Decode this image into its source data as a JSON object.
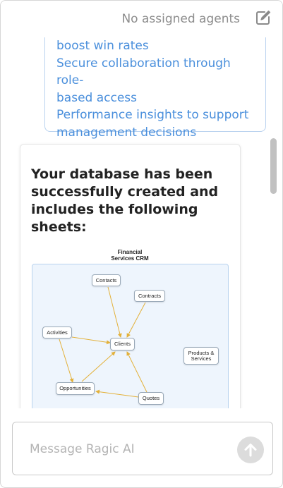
{
  "header": {
    "agents_text": "No assigned agents",
    "edit_icon": "edit-icon"
  },
  "user_message": {
    "lines": [
      "boost win rates",
      "Secure collaboration through role-",
      "based access",
      "Performance insights to support",
      "management decisions"
    ]
  },
  "ai_message": {
    "heading_lines": [
      "Your database has been",
      "successfully created and",
      "includes the following",
      "sheets:"
    ],
    "diagram": {
      "title_lines": [
        "Financial",
        "Services CRM"
      ],
      "nodes": {
        "contacts": "Contacts",
        "contracts": "Contracts",
        "activities": "Activities",
        "clients": "Clients",
        "products_services": [
          "Products &",
          "Services"
        ],
        "opportunities": "Opportunities",
        "quotes": "Quotes"
      }
    }
  },
  "composer": {
    "placeholder": "Message Ragic AI",
    "value": "",
    "send_icon": "arrow-up-icon"
  },
  "colors": {
    "accent_text": "#4a8fdc",
    "diagram_bg": "#eef5fd",
    "arrow": "#e3b13a"
  }
}
